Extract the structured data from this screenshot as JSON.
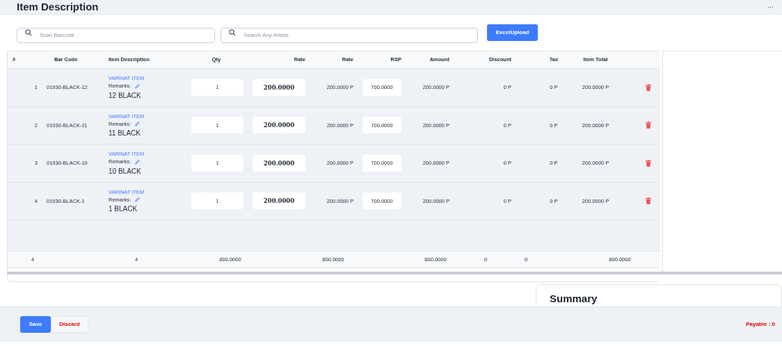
{
  "header": {
    "title": "Item Description",
    "menu": "···"
  },
  "search": [
    {
      "placeholder": "Scan Barcode"
    },
    {
      "placeholder": "Search Any Article"
    }
  ],
  "upload_button": "ExcelUpload",
  "table": {
    "columns": [
      "#",
      "Bar Code",
      "Item Description",
      "Qty",
      "Rate",
      "Rate",
      "RSP",
      "Amount",
      "Discount",
      "Tax",
      "Item Total"
    ],
    "rows": [
      {
        "index": "1",
        "barcode": "01930-BLACK-12",
        "variant": "VARINAT ITEM",
        "remarks": "Remarks:",
        "name": "12 BLACK",
        "qty": "1",
        "rate": "200.0000",
        "rate2": "200.0000 P",
        "rsp": "700.0000",
        "amount": "200.0000 P",
        "discount": "0 P",
        "tax": "0 P",
        "total": "200.0000 P"
      },
      {
        "index": "2",
        "barcode": "01930-BLACK-11",
        "variant": "VARINAT ITEM",
        "remarks": "Remarks:",
        "name": "11 BLACK",
        "qty": "1",
        "rate": "200.0000",
        "rate2": "200.0000 P",
        "rsp": "700.0000",
        "amount": "200.0000 P",
        "discount": "0 P",
        "tax": "0 P",
        "total": "200.0000 P"
      },
      {
        "index": "3",
        "barcode": "01930-BLACK-10",
        "variant": "VARINAT ITEM",
        "remarks": "Remarks:",
        "name": "10 BLACK",
        "qty": "1",
        "rate": "200.0000",
        "rate2": "200.0000 P",
        "rsp": "700.0000",
        "amount": "200.0000 P",
        "discount": "0 P",
        "tax": "0 P",
        "total": "200.0000 P"
      },
      {
        "index": "4",
        "barcode": "01930-BLACK-1",
        "variant": "VARINAT ITEM",
        "remarks": "Remarks:",
        "name": "1 BLACK",
        "qty": "1",
        "rate": "200.0000",
        "rate2": "200.0000 P",
        "rsp": "700.0000",
        "amount": "200.0000 P",
        "discount": "0 P",
        "tax": "0 P",
        "total": "200.0000 P"
      }
    ],
    "totals": [
      "4",
      "4",
      "800.0000",
      "800.0000",
      "800.0000",
      "0",
      "0",
      "800.0000"
    ]
  },
  "summary": {
    "title": "Summary"
  },
  "footer": {
    "save": "Save",
    "discard": "Discard",
    "payable": "Payable : 0"
  }
}
